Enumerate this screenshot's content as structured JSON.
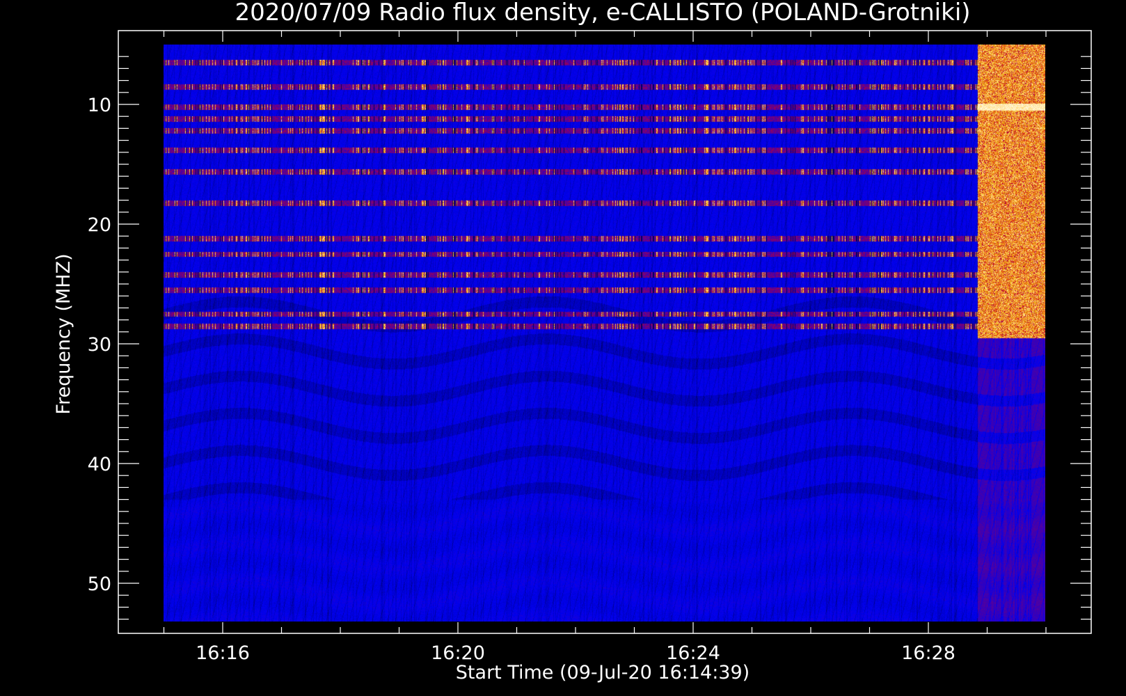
{
  "chart_data": {
    "type": "heatmap",
    "title": "2020/07/09  Radio flux density, e-CALLISTO (POLAND-Grotniki)",
    "xlabel": "Start Time (09-Jul-20 16:14:39)",
    "ylabel": "Frequency (MHZ)",
    "x_ticks": [
      "16:16",
      "16:20",
      "16:24",
      "16:28"
    ],
    "y_ticks": [
      "10",
      "20",
      "30",
      "40",
      "50"
    ],
    "x_range": [
      "16:14:39",
      "16:30:00"
    ],
    "y_range": [
      5,
      53
    ],
    "y_inverted": true,
    "colormap": [
      "#000000",
      "#0000ff",
      "#ff0000",
      "#ffff00",
      "#ffffff"
    ],
    "background_color": "#1a1aee",
    "frame_color": "#ffffff",
    "emission_bands_mhz": [
      6.5,
      8.5,
      10.2,
      11.2,
      12.2,
      13.8,
      15.6,
      18.2,
      21.2,
      22.5,
      24.2,
      25.5,
      27.5,
      28.5
    ],
    "burst_time_range": [
      "16:28:50",
      "16:30:00"
    ],
    "burst_freq_range_mhz": [
      5,
      29.5
    ]
  }
}
